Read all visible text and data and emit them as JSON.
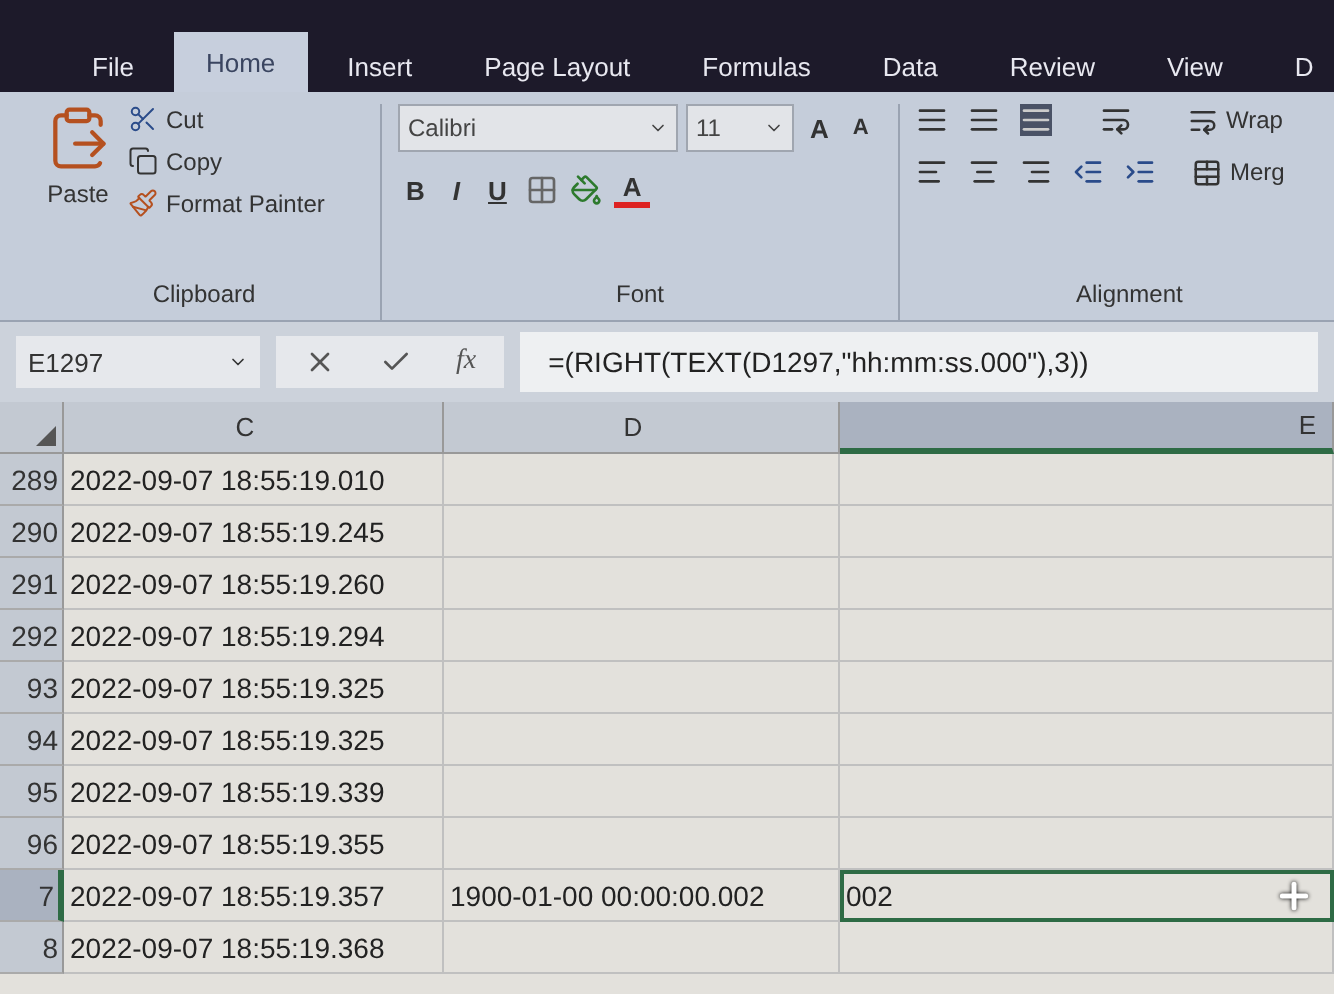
{
  "tabs": [
    {
      "label": "File",
      "selected": false
    },
    {
      "label": "Home",
      "selected": true
    },
    {
      "label": "Insert",
      "selected": false
    },
    {
      "label": "Page Layout",
      "selected": false
    },
    {
      "label": "Formulas",
      "selected": false
    },
    {
      "label": "Data",
      "selected": false
    },
    {
      "label": "Review",
      "selected": false
    },
    {
      "label": "View",
      "selected": false
    },
    {
      "label": "D",
      "selected": false
    }
  ],
  "clipboard": {
    "paste": "Paste",
    "items": [
      {
        "kind": "cut",
        "label": "Cut"
      },
      {
        "kind": "copy",
        "label": "Copy"
      },
      {
        "kind": "painter",
        "label": "Format Painter"
      }
    ],
    "label": "Clipboard"
  },
  "font": {
    "name": "Calibri",
    "size": "11",
    "grow": "A",
    "shrink": "A",
    "styles": [
      "B",
      "I",
      "U"
    ],
    "color_letter": "A",
    "label": "Font"
  },
  "alignment": {
    "wrap": "Wrap",
    "merge": "Merg",
    "label": "Alignment"
  },
  "formula_bar": {
    "name_box": "E1297",
    "fx": "fx",
    "formula": "=(RIGHT(TEXT(D1297,\"hh:mm:ss.000\"),3))"
  },
  "columns": [
    {
      "label": "C",
      "selected": false
    },
    {
      "label": "D",
      "selected": false
    },
    {
      "label": "E",
      "selected": true
    }
  ],
  "rows": [
    {
      "header": "289",
      "c": "2022-09-07 18:55:19.010",
      "d": "",
      "e": "",
      "selected": false
    },
    {
      "header": "290",
      "c": "2022-09-07 18:55:19.245",
      "d": "",
      "e": "",
      "selected": false
    },
    {
      "header": "291",
      "c": "2022-09-07 18:55:19.260",
      "d": "",
      "e": "",
      "selected": false
    },
    {
      "header": "292",
      "c": "2022-09-07 18:55:19.294",
      "d": "",
      "e": "",
      "selected": false
    },
    {
      "header": "93",
      "c": "2022-09-07 18:55:19.325",
      "d": "",
      "e": "",
      "selected": false
    },
    {
      "header": "94",
      "c": "2022-09-07 18:55:19.325",
      "d": "",
      "e": "",
      "selected": false
    },
    {
      "header": "95",
      "c": "2022-09-07 18:55:19.339",
      "d": "",
      "e": "",
      "selected": false
    },
    {
      "header": "96",
      "c": "2022-09-07 18:55:19.355",
      "d": "",
      "e": "",
      "selected": false
    },
    {
      "header": "7",
      "c": "2022-09-07 18:55:19.357",
      "d": "1900-01-00 00:00:00.002",
      "e": "002",
      "selected": true
    },
    {
      "header": "8",
      "c": "2022-09-07 18:55:19.368",
      "d": "",
      "e": "",
      "selected": false
    }
  ]
}
